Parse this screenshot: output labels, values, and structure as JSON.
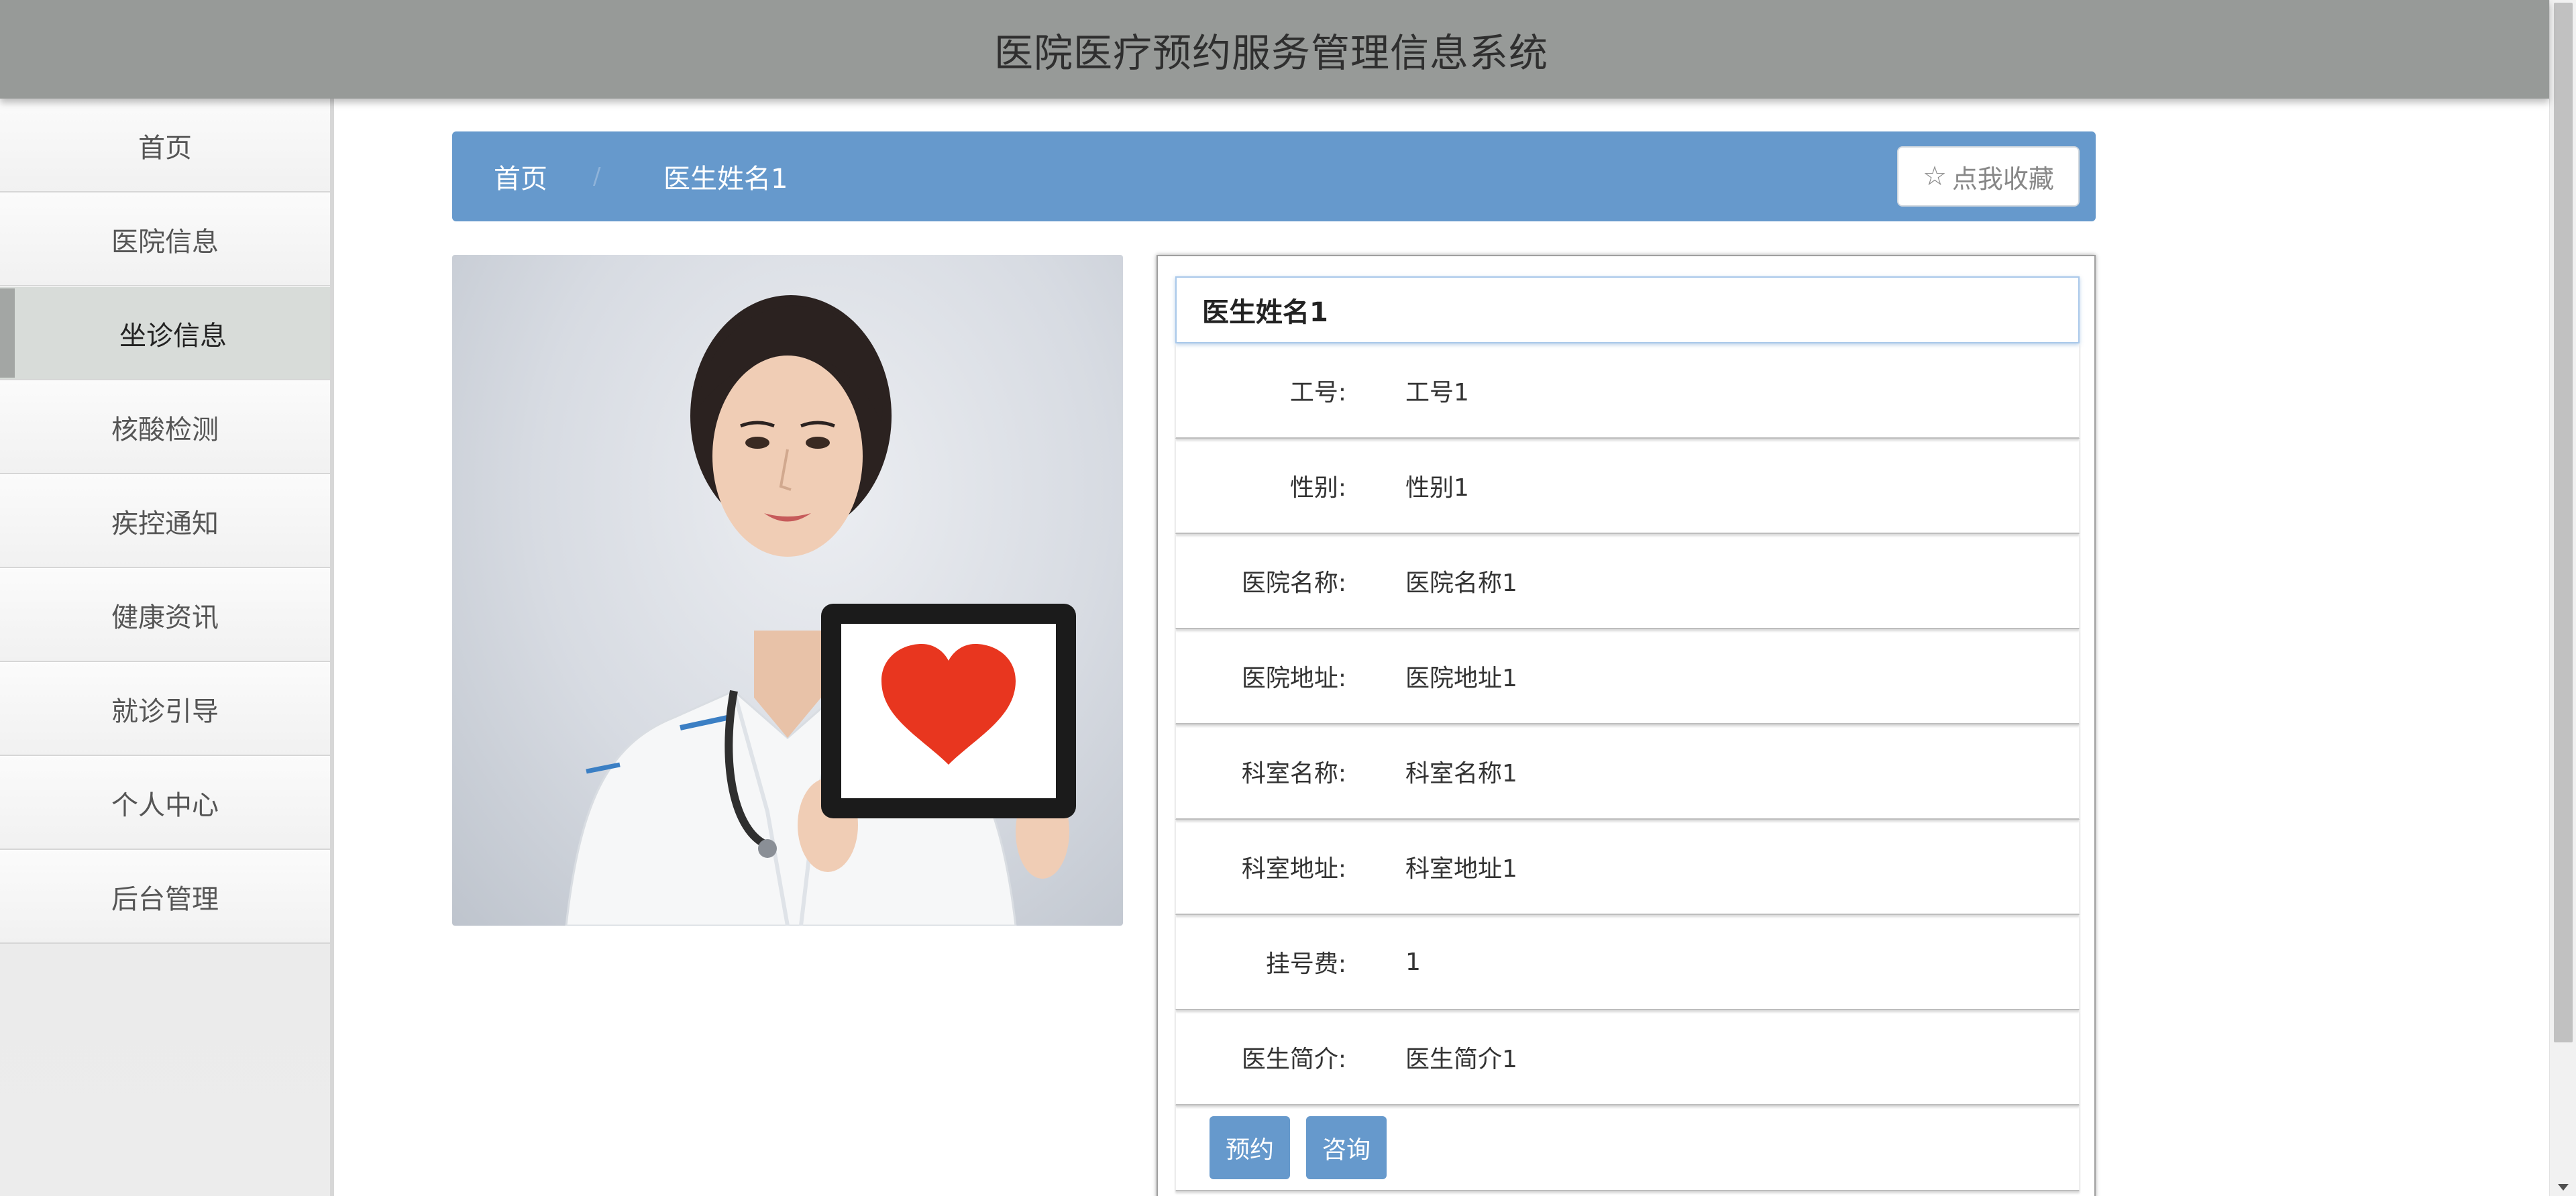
{
  "header": {
    "title": "医院医疗预约服务管理信息系统"
  },
  "sidebar": {
    "items": [
      {
        "label": "首页",
        "active": false
      },
      {
        "label": "医院信息",
        "active": false
      },
      {
        "label": "坐诊信息",
        "active": true
      },
      {
        "label": "核酸检测",
        "active": false
      },
      {
        "label": "疾控通知",
        "active": false
      },
      {
        "label": "健康资讯",
        "active": false
      },
      {
        "label": "就诊引导",
        "active": false
      },
      {
        "label": "个人中心",
        "active": false
      },
      {
        "label": "后台管理",
        "active": false
      }
    ]
  },
  "breadcrumb": {
    "home": "首页",
    "separator": "/",
    "current": "医生姓名1",
    "favorite_label": "点我收藏",
    "favorite_icon": "star-outline-icon"
  },
  "detail": {
    "title": "医生姓名1",
    "fields": [
      {
        "key": "工号:",
        "value": "工号1"
      },
      {
        "key": "性别:",
        "value": "性别1"
      },
      {
        "key": "医院名称:",
        "value": "医院名称1"
      },
      {
        "key": "医院地址:",
        "value": "医院地址1"
      },
      {
        "key": "科室名称:",
        "value": "科室名称1"
      },
      {
        "key": "科室地址:",
        "value": "科室地址1"
      },
      {
        "key": "挂号费:",
        "value": "1"
      },
      {
        "key": "医生简介:",
        "value": "医生简介1"
      }
    ],
    "actions": {
      "book": "预约",
      "consult": "咨询"
    }
  },
  "colors": {
    "header_bg": "#979a98",
    "accent": "#6699cc",
    "sidebar_active": "#d8dcd9",
    "heart": "#e8361f"
  }
}
